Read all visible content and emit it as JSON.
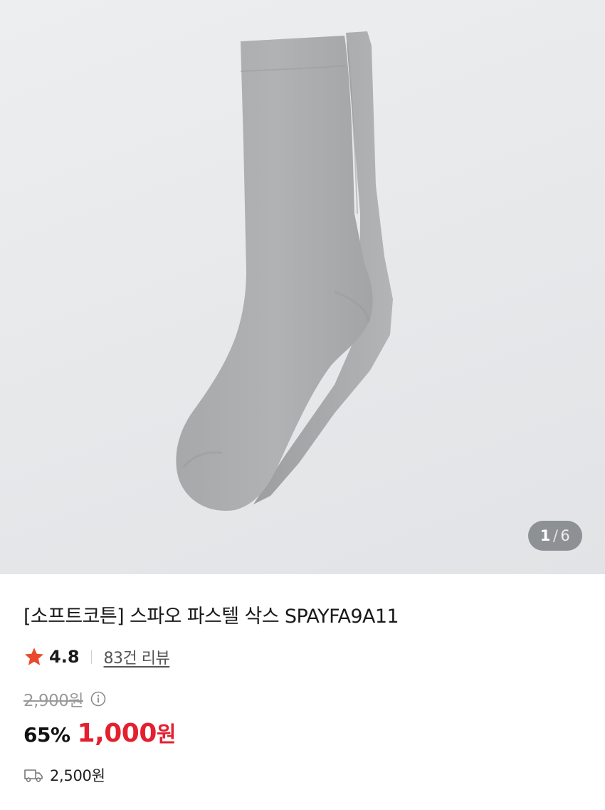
{
  "gallery": {
    "image_icon": "gray-crew-sock-photo",
    "indicator_current": "1",
    "indicator_separator": "/",
    "indicator_total": "6"
  },
  "product": {
    "title": "[소프트코튼] 스파오 파스텔 삭스 SPAYFA9A11",
    "rating": "4.8",
    "review_link": "83건 리뷰",
    "original_price": "2,900원",
    "discount_rate": "65%",
    "sale_price": "1,000",
    "sale_unit": "원",
    "shipping_fee": "2,500원"
  },
  "icons": {
    "rating": "star-icon",
    "price_info": "info-circle-icon",
    "shipping": "truck-icon"
  },
  "colors": {
    "star": "#ea4a2b",
    "sale_price": "#e4202f",
    "original_price": "#9a9a9a",
    "gallery_bg": "#e6e8ea",
    "sock": "#a9abad"
  }
}
